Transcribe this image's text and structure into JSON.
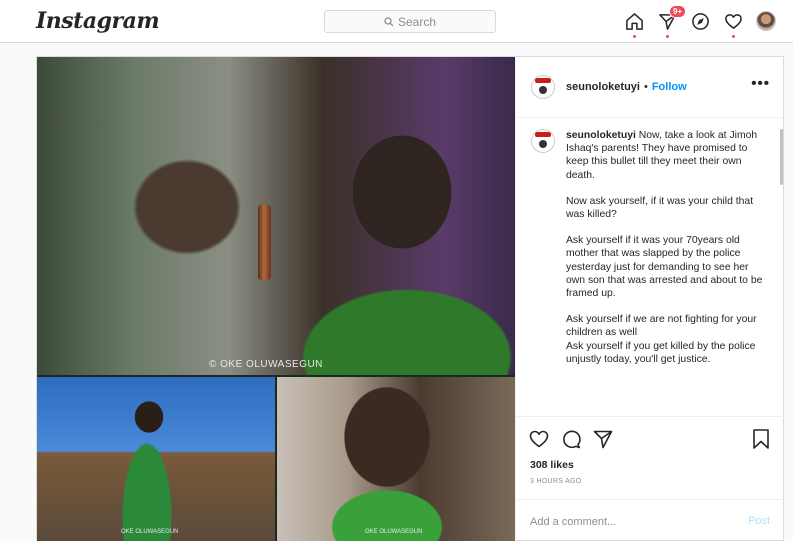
{
  "header": {
    "logo": "Instagram",
    "search_placeholder": "Search",
    "activity_badge": "9+",
    "icons": [
      "home-icon",
      "direct-icon",
      "explore-icon",
      "heart-icon",
      "profile-avatar"
    ]
  },
  "post": {
    "username": "seunoloketuyi",
    "separator": "•",
    "follow_label": "Follow",
    "more_label": "•••",
    "photo_watermark": "© OKE OLUWASEGUN",
    "photo_watermark_small": "OKE OLUWASEGUN",
    "caption": {
      "username": "seunoloketuyi",
      "paragraphs": [
        "Now, take a look at Jimoh Ishaq's parents! They have promised to keep this bullet till they meet their own death.",
        "Now ask yourself, if it was your child that was killed?",
        "Ask yourself if it was your 70years old mother that was slapped by the police yesterday just for demanding to see her own son that was arrested and about to be framed up.",
        "Ask yourself if we are not fighting for your children as well",
        "Ask yourself if you get killed by the police unjustly today, you'll get justice."
      ]
    },
    "likes": "308 likes",
    "timestamp": "3 HOURS AGO",
    "comment_placeholder": "Add a comment...",
    "post_label": "Post"
  },
  "colors": {
    "accent_blue": "#0095f6",
    "notification_red": "#ed4956",
    "border": "#dbdbdb"
  }
}
